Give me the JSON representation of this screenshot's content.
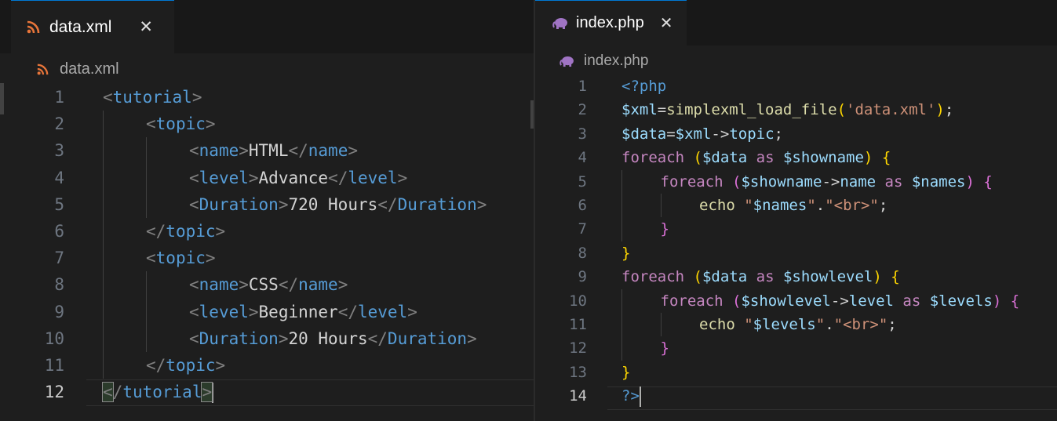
{
  "left": {
    "tab": {
      "label": "data.xml",
      "icon": "rss-icon",
      "close": "✕"
    },
    "breadcrumb": {
      "label": "data.xml",
      "icon": "rss-icon"
    },
    "active_line": 12,
    "lines": [
      {
        "n": "1",
        "indent": 0,
        "tokens": [
          [
            "<",
            "punc"
          ],
          [
            "tutorial",
            "tag"
          ],
          [
            ">",
            "punc"
          ]
        ]
      },
      {
        "n": "2",
        "indent": 1,
        "tokens": [
          [
            "<",
            "punc"
          ],
          [
            "topic",
            "tag"
          ],
          [
            ">",
            "punc"
          ]
        ]
      },
      {
        "n": "3",
        "indent": 2,
        "tokens": [
          [
            "<",
            "punc"
          ],
          [
            "name",
            "tag"
          ],
          [
            ">",
            "punc"
          ],
          [
            "HTML",
            "text"
          ],
          [
            "</",
            "punc"
          ],
          [
            "name",
            "tag"
          ],
          [
            ">",
            "punc"
          ]
        ]
      },
      {
        "n": "4",
        "indent": 2,
        "tokens": [
          [
            "<",
            "punc"
          ],
          [
            "level",
            "tag"
          ],
          [
            ">",
            "punc"
          ],
          [
            "Advance",
            "text"
          ],
          [
            "</",
            "punc"
          ],
          [
            "level",
            "tag"
          ],
          [
            ">",
            "punc"
          ]
        ]
      },
      {
        "n": "5",
        "indent": 2,
        "tokens": [
          [
            "<",
            "punc"
          ],
          [
            "Duration",
            "tag"
          ],
          [
            ">",
            "punc"
          ],
          [
            "720 Hours",
            "text"
          ],
          [
            "</",
            "punc"
          ],
          [
            "Duration",
            "tag"
          ],
          [
            ">",
            "punc"
          ]
        ]
      },
      {
        "n": "6",
        "indent": 1,
        "tokens": [
          [
            "</",
            "punc"
          ],
          [
            "topic",
            "tag"
          ],
          [
            ">",
            "punc"
          ]
        ]
      },
      {
        "n": "7",
        "indent": 1,
        "tokens": [
          [
            "<",
            "punc"
          ],
          [
            "topic",
            "tag"
          ],
          [
            ">",
            "punc"
          ]
        ]
      },
      {
        "n": "8",
        "indent": 2,
        "tokens": [
          [
            "<",
            "punc"
          ],
          [
            "name",
            "tag"
          ],
          [
            ">",
            "punc"
          ],
          [
            "CSS",
            "text"
          ],
          [
            "</",
            "punc"
          ],
          [
            "name",
            "tag"
          ],
          [
            ">",
            "punc"
          ]
        ]
      },
      {
        "n": "9",
        "indent": 2,
        "tokens": [
          [
            "<",
            "punc"
          ],
          [
            "level",
            "tag"
          ],
          [
            ">",
            "punc"
          ],
          [
            "Beginner",
            "text"
          ],
          [
            "</",
            "punc"
          ],
          [
            "level",
            "tag"
          ],
          [
            ">",
            "punc"
          ]
        ]
      },
      {
        "n": "10",
        "indent": 2,
        "tokens": [
          [
            "<",
            "punc"
          ],
          [
            "Duration",
            "tag"
          ],
          [
            ">",
            "punc"
          ],
          [
            "20 Hours",
            "text"
          ],
          [
            "</",
            "punc"
          ],
          [
            "Duration",
            "tag"
          ],
          [
            ">",
            "punc"
          ]
        ]
      },
      {
        "n": "11",
        "indent": 1,
        "tokens": [
          [
            "</",
            "punc"
          ],
          [
            "topic",
            "tag"
          ],
          [
            ">",
            "punc"
          ]
        ]
      },
      {
        "n": "12",
        "indent": 0,
        "tokens": [
          [
            "<",
            "match"
          ],
          [
            "/",
            "punc"
          ],
          [
            "tutorial",
            "tag"
          ],
          [
            ">",
            "match"
          ]
        ]
      }
    ]
  },
  "right": {
    "tab": {
      "label": "index.php",
      "icon": "php-elephant-icon",
      "close": "✕"
    },
    "breadcrumb": {
      "label": "index.php",
      "icon": "php-elephant-icon"
    },
    "active_line": 14,
    "lines": [
      {
        "n": "1",
        "indent": 0,
        "tokens": [
          [
            "<?php",
            "php"
          ]
        ]
      },
      {
        "n": "2",
        "indent": 0,
        "tokens": [
          [
            "$xml",
            "var"
          ],
          [
            "=",
            "plain"
          ],
          [
            "simplexml_load_file",
            "func"
          ],
          [
            "(",
            "b1"
          ],
          [
            "'data.xml'",
            "str"
          ],
          [
            ")",
            "b1"
          ],
          [
            ";",
            "plain"
          ]
        ]
      },
      {
        "n": "3",
        "indent": 0,
        "tokens": [
          [
            "$data",
            "var"
          ],
          [
            "=",
            "plain"
          ],
          [
            "$xml",
            "var"
          ],
          [
            "->",
            "plain"
          ],
          [
            "topic",
            "var"
          ],
          [
            ";",
            "plain"
          ]
        ]
      },
      {
        "n": "4",
        "indent": 0,
        "tokens": [
          [
            "foreach",
            "kw"
          ],
          [
            " ",
            "plain"
          ],
          [
            "(",
            "b1"
          ],
          [
            "$data",
            "var"
          ],
          [
            " as ",
            "kw"
          ],
          [
            "$showname",
            "var"
          ],
          [
            ")",
            "b1"
          ],
          [
            " ",
            "plain"
          ],
          [
            "{",
            "b1"
          ]
        ]
      },
      {
        "n": "5",
        "indent": 1,
        "tokens": [
          [
            "foreach",
            "kw"
          ],
          [
            " ",
            "plain"
          ],
          [
            "(",
            "b2"
          ],
          [
            "$showname",
            "var"
          ],
          [
            "->",
            "plain"
          ],
          [
            "name",
            "var"
          ],
          [
            " as ",
            "kw"
          ],
          [
            "$names",
            "var"
          ],
          [
            ")",
            "b2"
          ],
          [
            " ",
            "plain"
          ],
          [
            "{",
            "b2"
          ]
        ]
      },
      {
        "n": "6",
        "indent": 2,
        "tokens": [
          [
            "echo",
            "func"
          ],
          [
            " ",
            "plain"
          ],
          [
            "\"",
            "str"
          ],
          [
            "$names",
            "var"
          ],
          [
            "\"",
            "str"
          ],
          [
            ".",
            "plain"
          ],
          [
            "\"<br>\"",
            "str"
          ],
          [
            ";",
            "plain"
          ]
        ]
      },
      {
        "n": "7",
        "indent": 1,
        "tokens": [
          [
            "}",
            "b2"
          ]
        ]
      },
      {
        "n": "8",
        "indent": 0,
        "tokens": [
          [
            "}",
            "b1"
          ]
        ]
      },
      {
        "n": "9",
        "indent": 0,
        "tokens": [
          [
            "foreach",
            "kw"
          ],
          [
            " ",
            "plain"
          ],
          [
            "(",
            "b1"
          ],
          [
            "$data",
            "var"
          ],
          [
            " as ",
            "kw"
          ],
          [
            "$showlevel",
            "var"
          ],
          [
            ")",
            "b1"
          ],
          [
            " ",
            "plain"
          ],
          [
            "{",
            "b1"
          ]
        ]
      },
      {
        "n": "10",
        "indent": 1,
        "tokens": [
          [
            "foreach",
            "kw"
          ],
          [
            " ",
            "plain"
          ],
          [
            "(",
            "b2"
          ],
          [
            "$showlevel",
            "var"
          ],
          [
            "->",
            "plain"
          ],
          [
            "level",
            "var"
          ],
          [
            " as ",
            "kw"
          ],
          [
            "$levels",
            "var"
          ],
          [
            ")",
            "b2"
          ],
          [
            " ",
            "plain"
          ],
          [
            "{",
            "b2"
          ]
        ]
      },
      {
        "n": "11",
        "indent": 2,
        "tokens": [
          [
            "echo",
            "func"
          ],
          [
            " ",
            "plain"
          ],
          [
            "\"",
            "str"
          ],
          [
            "$levels",
            "var"
          ],
          [
            "\"",
            "str"
          ],
          [
            ".",
            "plain"
          ],
          [
            "\"<br>\"",
            "str"
          ],
          [
            ";",
            "plain"
          ]
        ]
      },
      {
        "n": "12",
        "indent": 1,
        "tokens": [
          [
            "}",
            "b2"
          ]
        ]
      },
      {
        "n": "13",
        "indent": 0,
        "tokens": [
          [
            "}",
            "b1"
          ]
        ]
      },
      {
        "n": "14",
        "indent": 0,
        "tokens": [
          [
            "?>",
            "php"
          ]
        ]
      }
    ]
  },
  "colors": {
    "tag": "#569cd6",
    "punc": "#808080",
    "var": "#9cdcfe",
    "func": "#dcdcaa",
    "str": "#ce9178",
    "keyword": "#c586c0",
    "bracket1": "#ffd700",
    "bracket2": "#da70d6",
    "rss": "#e8753a",
    "php": "#a074c4",
    "accent": "#0078d4"
  }
}
